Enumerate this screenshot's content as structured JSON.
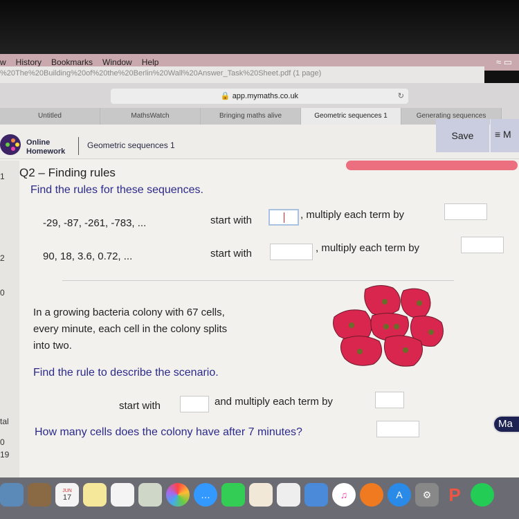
{
  "menubar": {
    "items": [
      "w",
      "History",
      "Bookmarks",
      "Window",
      "Help"
    ],
    "wifi_icon": "wifi-icon"
  },
  "pdf_title": "%20The%20Building%20of%20the%20Berlin%20Wall%20Answer_Task%20Sheet.pdf (1 page)",
  "browser": {
    "url": "app.mymaths.co.uk",
    "tabs": [
      "Untitled",
      "MathsWatch",
      "Bringing maths alive",
      "Geometric sequences 1",
      "Generating sequences"
    ],
    "active_tab": 3
  },
  "header": {
    "brand_line1": "Online",
    "brand_line2": "Homework",
    "breadcrumb": "Geometric sequences 1",
    "save": "Save",
    "menu": "≡ M"
  },
  "sidebar": {
    "items": [
      "1",
      "2",
      "0",
      "tal",
      "0",
      "19"
    ]
  },
  "question": {
    "title": "Q2 – Finding rules",
    "instruction": "Find the rules for these sequences.",
    "sequences": [
      {
        "terms": "-29, -87, -261, -783, ...",
        "start_label": "start with",
        "start_value": "",
        "mult_label": ", multiply each term by",
        "mult_value": ""
      },
      {
        "terms": "90, 18, 3.6, 0.72, ...",
        "start_label": "start with",
        "start_value": "",
        "mult_label": ", multiply each term by",
        "mult_value": ""
      }
    ],
    "scenario": "In a growing bacteria colony with 67 cells, every minute, each cell in the colony splits into two.",
    "find_rule": "Find the rule to describe the scenario.",
    "rule_start_label": "start with",
    "rule_mult_label": "and multiply each term by",
    "how_many": "How many cells does the colony have after 7 minutes?",
    "answer": ""
  },
  "corner_button": "Ma",
  "dock": {
    "calendar_month": "JUN",
    "calendar_day": "17",
    "icons": [
      "finder-icon",
      "contacts-icon",
      "calendar-icon",
      "notes-icon",
      "reminders-icon",
      "preview-icon",
      "photos-icon",
      "messages-icon",
      "facetime-icon",
      "pages-icon",
      "numbers-icon",
      "keynote-icon",
      "itunes-icon",
      "ibooks-icon",
      "app-store-icon",
      "system-preferences-icon",
      "powerpoint-icon",
      "spotify-icon"
    ]
  },
  "colors": {
    "instruction_blue": "#2b2a8a",
    "cell_red": "#d9264f",
    "nucleus": "#6b6b2a",
    "save_bg": "#c9cddf"
  }
}
